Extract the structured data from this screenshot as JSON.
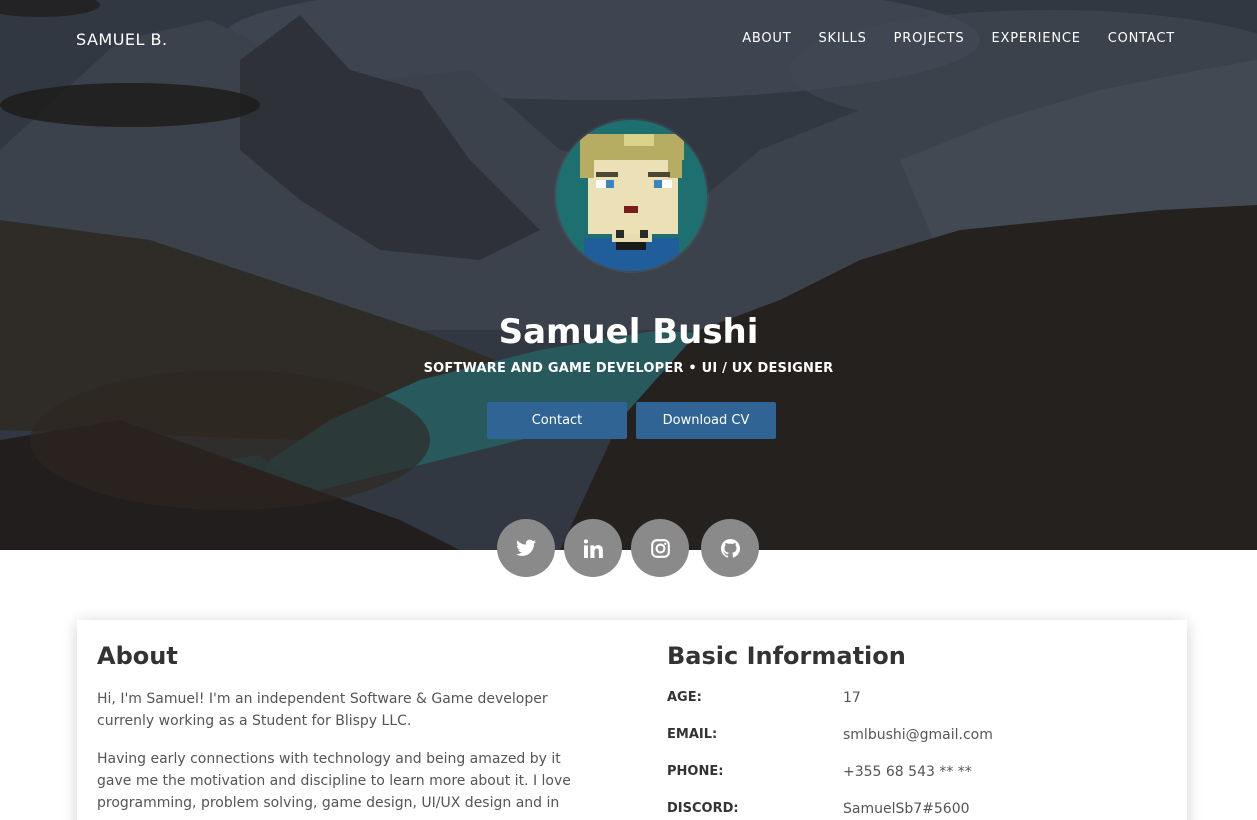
{
  "header": {
    "brand": "SAMUEL B.",
    "nav": [
      "ABOUT",
      "SKILLS",
      "PROJECTS",
      "EXPERIENCE",
      "CONTACT"
    ]
  },
  "hero": {
    "name": "Samuel Bushi",
    "subtitle": "SOFTWARE AND GAME DEVELOPER • UI / UX DESIGNER",
    "contact_button": "Contact",
    "cv_button": "Download CV"
  },
  "social": [
    {
      "icon": "twitter-icon"
    },
    {
      "icon": "linkedin-icon"
    },
    {
      "icon": "instagram-icon"
    },
    {
      "icon": "github-icon"
    }
  ],
  "about": {
    "title": "About",
    "paragraph1": "Hi, I'm Samuel! I'm an independent Software & Game developer currenly working as a Student for Blispy LLC.",
    "paragraph2": "Having early connections with technology and being amazed by it gave me the motivation and discipline to learn more about it. I love programming, problem solving, game design, UI/UX design and in"
  },
  "basic_info": {
    "title": "Basic Information",
    "rows": [
      {
        "label": "AGE:",
        "value": "17"
      },
      {
        "label": "EMAIL:",
        "value": "smlbushi@gmail.com"
      },
      {
        "label": "PHONE:",
        "value": "+355 68 543 ** **"
      },
      {
        "label": "DISCORD:",
        "value": "SamuelSb7#5600"
      }
    ]
  },
  "colors": {
    "button_bg": "#2f6494",
    "social_bg": "#8a8a8a"
  }
}
